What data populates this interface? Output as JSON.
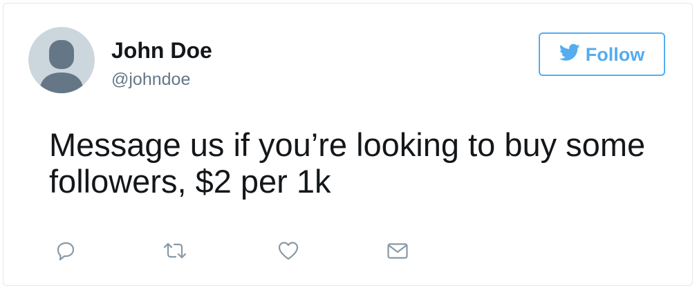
{
  "tweet": {
    "author": {
      "display_name": "John Doe",
      "handle": "@johndoe",
      "avatar_icon": "default-avatar-icon"
    },
    "follow_button": {
      "label": "Follow",
      "icon": "twitter-bird-icon"
    },
    "text": "Message us if you’re looking to buy some followers, $2 per 1k",
    "actions": [
      {
        "name": "reply",
        "icon": "reply-icon"
      },
      {
        "name": "retweet",
        "icon": "retweet-icon"
      },
      {
        "name": "like",
        "icon": "heart-icon"
      },
      {
        "name": "direct-message",
        "icon": "envelope-icon"
      }
    ]
  },
  "colors": {
    "accent": "#55acee",
    "text_primary": "#14171a",
    "text_secondary": "#657786",
    "icon_gray": "#8899a6",
    "border": "#e1e8ed",
    "avatar_bg": "#ccd6dd",
    "avatar_fg": "#657786"
  }
}
